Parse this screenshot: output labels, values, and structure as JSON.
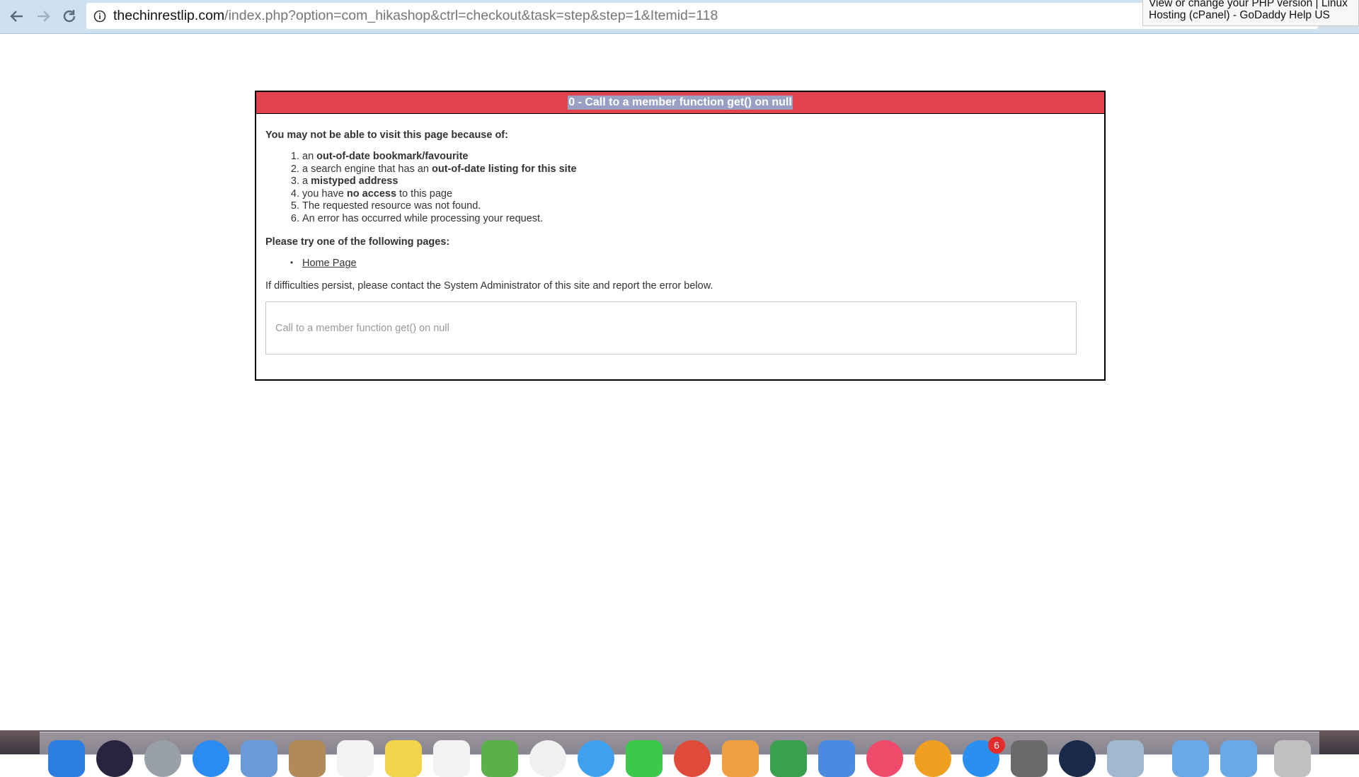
{
  "browser": {
    "url_domain": "thechinrestlip.com",
    "url_path": "/index.php?option=com_hikashop&ctrl=checkout&task=step&step=1&Itemid=118",
    "tooltip_line1": "View or change your PHP version | Linux",
    "tooltip_line2": "Hosting (cPanel) - GoDaddy Help US"
  },
  "error": {
    "title": "0 - Call to a member function get() on null",
    "intro": "You may not be able to visit this page because of:",
    "reasons": [
      {
        "pre": "an ",
        "bold": "out-of-date bookmark/favourite",
        "post": ""
      },
      {
        "pre": "a search engine that has an ",
        "bold": "out-of-date listing for this site",
        "post": ""
      },
      {
        "pre": "a ",
        "bold": "mistyped address",
        "post": ""
      },
      {
        "pre": "you have ",
        "bold": "no access",
        "post": " to this page"
      },
      {
        "pre": "The requested resource was not found.",
        "bold": "",
        "post": ""
      },
      {
        "pre": "An error has occurred while processing your request.",
        "bold": "",
        "post": ""
      }
    ],
    "try_heading": "Please try one of the following pages:",
    "home_link": "Home Page",
    "contact_text": "If difficulties persist, please contact the System Administrator of this site and report the error below.",
    "message_box": "Call to a member function get() on null"
  },
  "dock": {
    "badge_count": "6",
    "icons": [
      "finder-icon",
      "siri-icon",
      "launchpad-icon",
      "safari-icon",
      "mail-icon",
      "contacts-icon",
      "calendar-icon",
      "notes-icon",
      "reminders-icon",
      "maps-icon",
      "photos-icon",
      "messages-icon",
      "facetime-icon",
      "chrome-icon",
      "pages-icon",
      "numbers-icon",
      "keynote-icon",
      "itunes-icon",
      "ibooks-icon",
      "app-store-icon",
      "system-preferences-icon",
      "steam-icon",
      "preview-icon",
      "folder-icon",
      "downloads-folder-icon",
      "trash-icon"
    ],
    "colors": [
      "#2b7de0",
      "#2a2340",
      "#9aa0a8",
      "#2a8cf0",
      "#6a9ad8",
      "#b08a58",
      "#f2f2f2",
      "#f3d34a",
      "#f2f2f2",
      "#5ab04a",
      "#f0f0f0",
      "#40a0f0",
      "#3cc84a",
      "#e04a3a",
      "#f0a040",
      "#3aa050",
      "#4a8ae0",
      "#f04a6a",
      "#f0a020",
      "#2a90f0",
      "#6a6a6a",
      "#1a2a4a",
      "#a0b8d0",
      "#6aa8e8",
      "#6aa8e8",
      "#c0c0c0"
    ]
  }
}
